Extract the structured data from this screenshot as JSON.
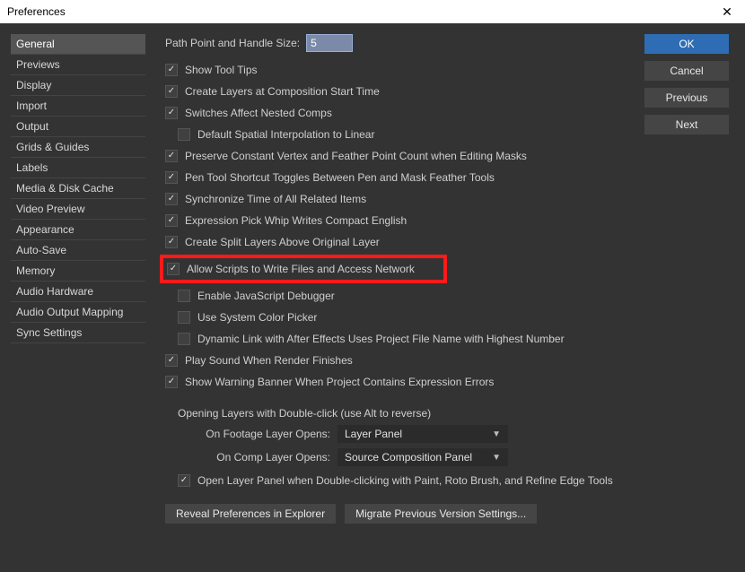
{
  "window": {
    "title": "Preferences",
    "close": "✕"
  },
  "sidebar": {
    "items": [
      {
        "label": "General",
        "selected": true
      },
      {
        "label": "Previews"
      },
      {
        "label": "Display"
      },
      {
        "label": "Import"
      },
      {
        "label": "Output"
      },
      {
        "label": "Grids & Guides"
      },
      {
        "label": "Labels"
      },
      {
        "label": "Media & Disk Cache"
      },
      {
        "label": "Video Preview"
      },
      {
        "label": "Appearance"
      },
      {
        "label": "Auto-Save"
      },
      {
        "label": "Memory"
      },
      {
        "label": "Audio Hardware"
      },
      {
        "label": "Audio Output Mapping"
      },
      {
        "label": "Sync Settings"
      }
    ]
  },
  "buttons": {
    "ok": "OK",
    "cancel": "Cancel",
    "previous": "Previous",
    "next": "Next"
  },
  "field": {
    "label": "Path Point and Handle Size:",
    "value": "5"
  },
  "checks": [
    {
      "label": "Show Tool Tips",
      "checked": true
    },
    {
      "label": "Create Layers at Composition Start Time",
      "checked": true
    },
    {
      "label": "Switches Affect Nested Comps",
      "checked": true
    },
    {
      "label": "Default Spatial Interpolation to Linear",
      "checked": false,
      "indent": true
    },
    {
      "label": "Preserve Constant Vertex and Feather Point Count when Editing Masks",
      "checked": true
    },
    {
      "label": "Pen Tool Shortcut Toggles Between Pen and Mask Feather Tools",
      "checked": true
    },
    {
      "label": "Synchronize Time of All Related Items",
      "checked": true
    },
    {
      "label": "Expression Pick Whip Writes Compact English",
      "checked": true
    },
    {
      "label": "Create Split Layers Above Original Layer",
      "checked": true
    },
    {
      "label": "Allow Scripts to Write Files and Access Network",
      "checked": true,
      "highlight": true
    },
    {
      "label": "Enable JavaScript Debugger",
      "checked": false,
      "indent": true
    },
    {
      "label": "Use System Color Picker",
      "checked": false,
      "indent": true
    },
    {
      "label": "Dynamic Link with After Effects Uses Project File Name with Highest Number",
      "checked": false,
      "indent": true
    },
    {
      "label": "Play Sound When Render Finishes",
      "checked": true
    },
    {
      "label": "Show Warning Banner When Project Contains Expression Errors",
      "checked": true
    }
  ],
  "group": {
    "title": "Opening Layers with Double-click (use Alt to reverse)",
    "rows": [
      {
        "label": "On Footage Layer Opens:",
        "value": "Layer Panel"
      },
      {
        "label": "On Comp Layer Opens:",
        "value": "Source Composition Panel"
      }
    ],
    "checkbox": {
      "label": "Open Layer Panel when Double-clicking with Paint, Roto Brush, and Refine Edge Tools",
      "checked": true
    }
  },
  "bottom": {
    "reveal": "Reveal Preferences in Explorer",
    "migrate": "Migrate Previous Version Settings..."
  }
}
